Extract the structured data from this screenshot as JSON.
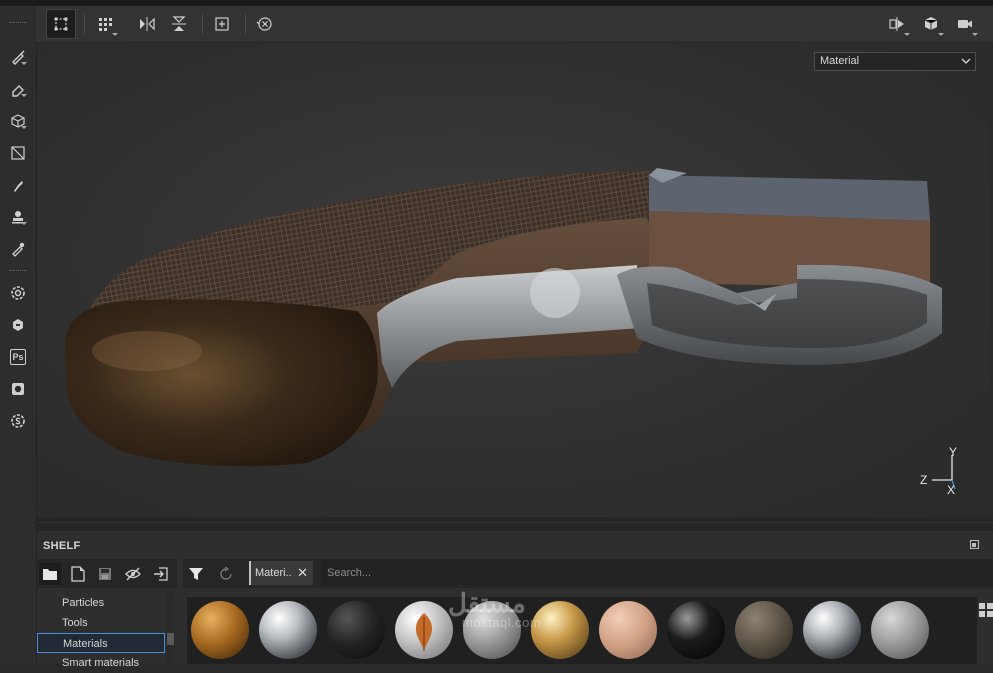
{
  "viewport": {
    "display_mode": "Material",
    "axis": {
      "x": "X",
      "y": "Y",
      "z": "Z"
    }
  },
  "shelf": {
    "title": "SHELF",
    "filter_tag": "Materi..",
    "filter_tag_close": "✕",
    "search_placeholder": "Search...",
    "categories": [
      {
        "label": "Particles"
      },
      {
        "label": "Tools"
      },
      {
        "label": "Materials"
      },
      {
        "label": "Smart materials"
      }
    ]
  },
  "watermark": {
    "arabic": "مستقل",
    "latin": "mostaql.com"
  },
  "colors": {
    "accent": "#4c8fd6",
    "panel": "#2e2e2e",
    "viewport": "#333333"
  }
}
